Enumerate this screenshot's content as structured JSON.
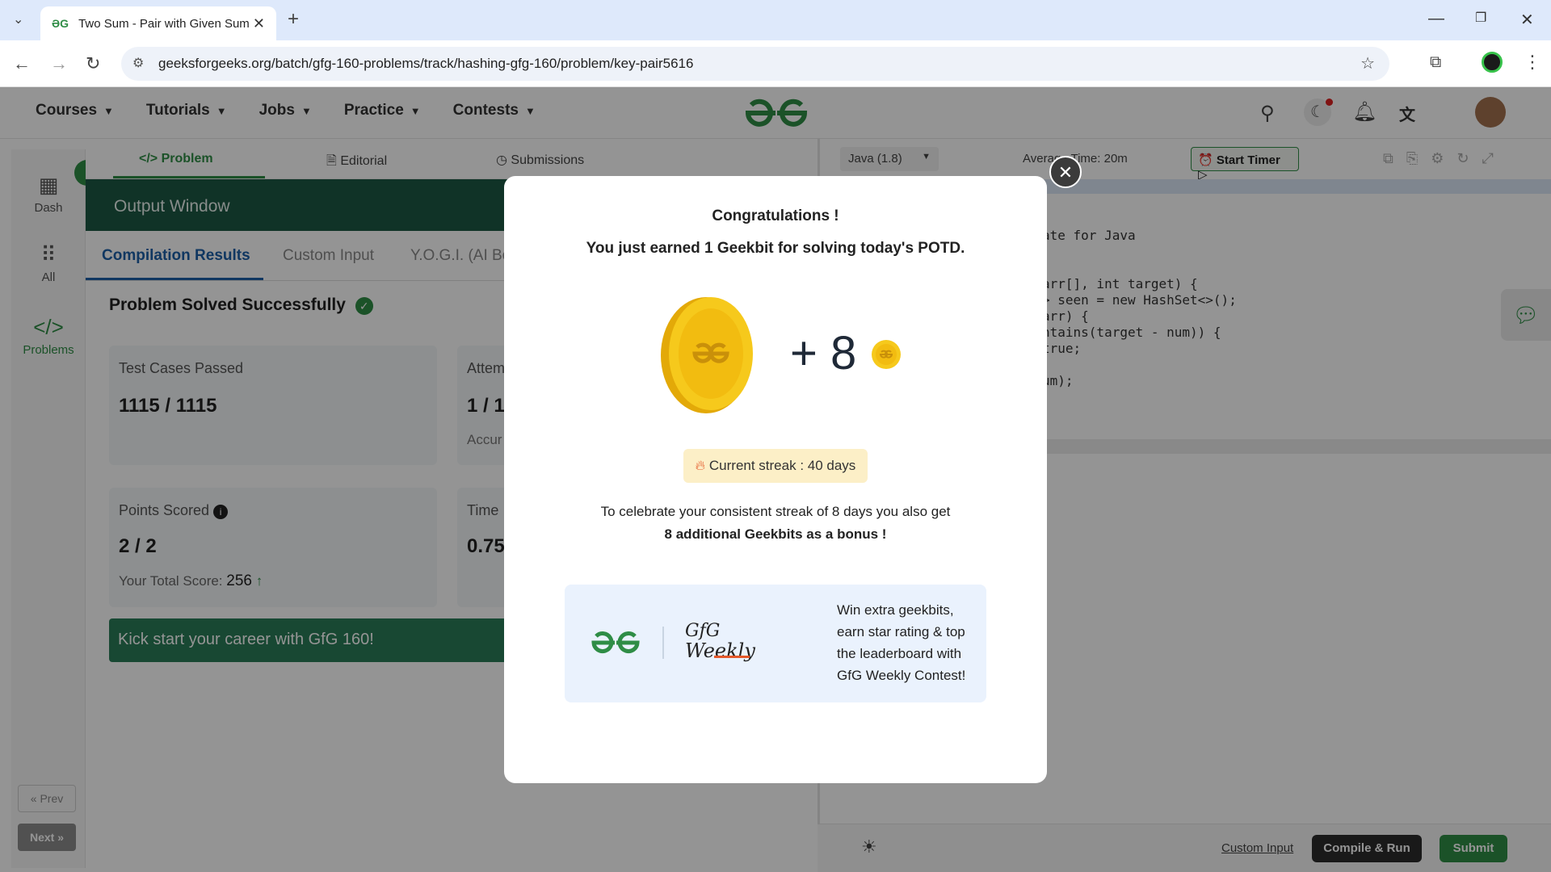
{
  "browser": {
    "tab_title": "Two Sum - Pair with Given Sum",
    "url": "geeksforgeeks.org/batch/gfg-160-problems/track/hashing-gfg-160/problem/key-pair5616"
  },
  "site_nav": {
    "courses": "Courses",
    "tutorials": "Tutorials",
    "jobs": "Jobs",
    "practice": "Practice",
    "contests": "Contests"
  },
  "rail": {
    "dash": "Dash",
    "all": "All",
    "problems": "Problems",
    "prev": "« Prev",
    "next": "Next »"
  },
  "panel_tabs": {
    "problem": "</> Problem",
    "editorial": "Editorial",
    "submissions": "Submissions"
  },
  "output": {
    "header": "Output Window",
    "tabs": [
      "Compilation Results",
      "Custom Input",
      "Y.O.G.I. (AI Bot"
    ],
    "status": "Problem Solved Successfully",
    "cards": {
      "tests_label": "Test Cases Passed",
      "tests_value": "1115 / 1115",
      "attempts_label": "Attem",
      "attempts_value": "1 / 1",
      "accuracy_label": "Accur",
      "points_label": "Points Scored",
      "points_value": "2 / 2",
      "total_label": "Your Total Score:",
      "total_value": "256",
      "time_label": "Time",
      "time_value": "0.75"
    },
    "banner": "Kick start your career with GfG 160!"
  },
  "editor": {
    "language": "Java (1.8)",
    "avg_time": "Average Time: 20m",
    "start_timer": "Start Timer",
    "code_lines": [
      "ate for Java",
      "",
      " arr[], int target) {",
      "> seen = new HashSet<>();",
      " arr) {",
      "ntains(target - num)) {",
      " true;",
      "",
      "um);"
    ],
    "custom_input": "Custom Input",
    "compile_run": "Compile & Run",
    "submit": "Submit"
  },
  "modal": {
    "title": "Congratulations !",
    "subtitle": "You just earned 1 Geekbit for solving today's POTD.",
    "plus": "+ 8",
    "streak": "Current streak : 40 days",
    "celebrate_line1": "To celebrate your consistent streak of 8 days you also get",
    "celebrate_line2": "8 additional Geekbits as a bonus !",
    "promo_brand_line1": "GfG",
    "promo_brand_line2": "Weekly",
    "promo_text": "Win extra geekbits, earn star rating & top the leaderboard with GfG Weekly Contest!"
  },
  "colors": {
    "brand_green": "#2f8d46",
    "dark_green": "#1c5944",
    "coin_gold": "#f2c21a"
  }
}
